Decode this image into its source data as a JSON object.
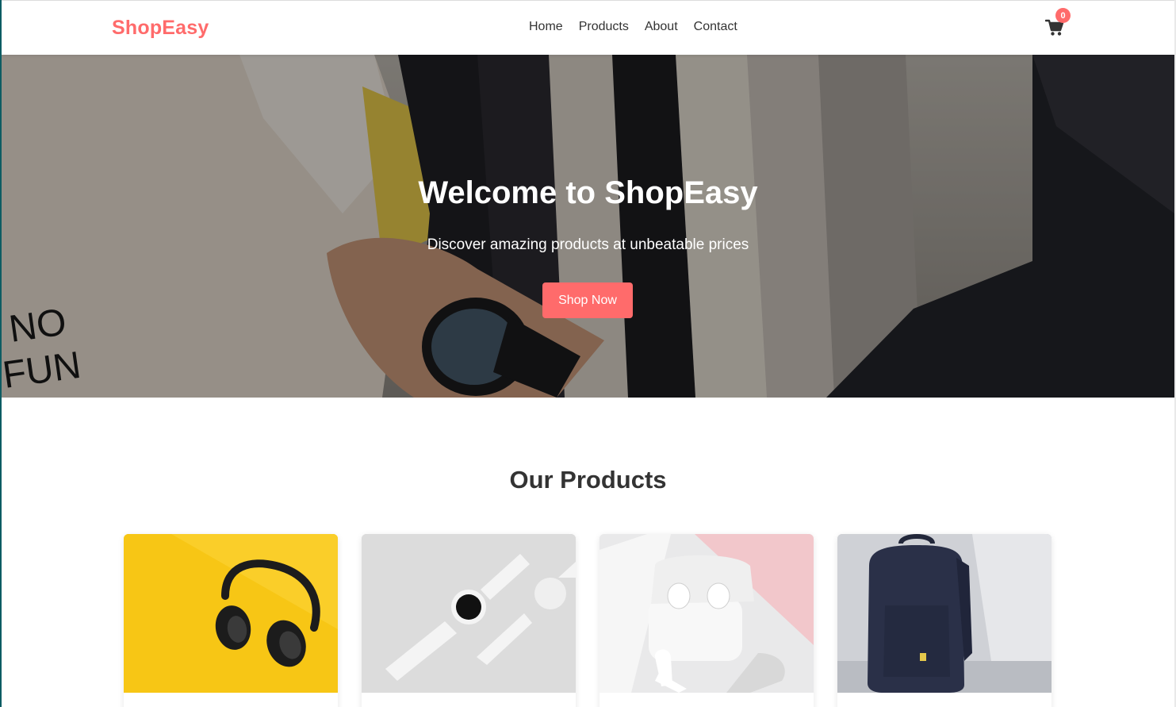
{
  "brand": {
    "name": "ShopEasy",
    "color": "#ff6b6b"
  },
  "nav": {
    "items": [
      {
        "label": "Home"
      },
      {
        "label": "Products"
      },
      {
        "label": "About"
      },
      {
        "label": "Contact"
      }
    ]
  },
  "cart": {
    "icon": "shopping-cart-icon",
    "count": "0"
  },
  "hero": {
    "title": "Welcome to ShopEasy",
    "subtitle": "Discover amazing products at unbeatable prices",
    "cta_label": "Shop Now"
  },
  "products": {
    "heading": "Our Products",
    "items": [
      {
        "image": "headphones-image",
        "background": "#f7c615"
      },
      {
        "image": "smartwatch-image",
        "background": "#dcdcdc"
      },
      {
        "image": "earbuds-image",
        "background": "#e9e9ea"
      },
      {
        "image": "backpack-image",
        "background": "#cfd1d6"
      }
    ]
  }
}
